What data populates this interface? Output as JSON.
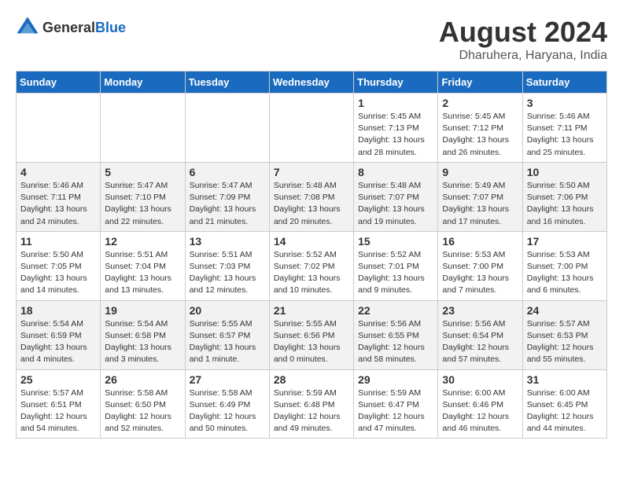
{
  "logo": {
    "text_general": "General",
    "text_blue": "Blue"
  },
  "title": "August 2024",
  "subtitle": "Dharuhera, Haryana, India",
  "days_header": [
    "Sunday",
    "Monday",
    "Tuesday",
    "Wednesday",
    "Thursday",
    "Friday",
    "Saturday"
  ],
  "weeks": [
    [
      {
        "num": "",
        "info": ""
      },
      {
        "num": "",
        "info": ""
      },
      {
        "num": "",
        "info": ""
      },
      {
        "num": "",
        "info": ""
      },
      {
        "num": "1",
        "info": "Sunrise: 5:45 AM\nSunset: 7:13 PM\nDaylight: 13 hours\nand 28 minutes."
      },
      {
        "num": "2",
        "info": "Sunrise: 5:45 AM\nSunset: 7:12 PM\nDaylight: 13 hours\nand 26 minutes."
      },
      {
        "num": "3",
        "info": "Sunrise: 5:46 AM\nSunset: 7:11 PM\nDaylight: 13 hours\nand 25 minutes."
      }
    ],
    [
      {
        "num": "4",
        "info": "Sunrise: 5:46 AM\nSunset: 7:11 PM\nDaylight: 13 hours\nand 24 minutes."
      },
      {
        "num": "5",
        "info": "Sunrise: 5:47 AM\nSunset: 7:10 PM\nDaylight: 13 hours\nand 22 minutes."
      },
      {
        "num": "6",
        "info": "Sunrise: 5:47 AM\nSunset: 7:09 PM\nDaylight: 13 hours\nand 21 minutes."
      },
      {
        "num": "7",
        "info": "Sunrise: 5:48 AM\nSunset: 7:08 PM\nDaylight: 13 hours\nand 20 minutes."
      },
      {
        "num": "8",
        "info": "Sunrise: 5:48 AM\nSunset: 7:07 PM\nDaylight: 13 hours\nand 19 minutes."
      },
      {
        "num": "9",
        "info": "Sunrise: 5:49 AM\nSunset: 7:07 PM\nDaylight: 13 hours\nand 17 minutes."
      },
      {
        "num": "10",
        "info": "Sunrise: 5:50 AM\nSunset: 7:06 PM\nDaylight: 13 hours\nand 16 minutes."
      }
    ],
    [
      {
        "num": "11",
        "info": "Sunrise: 5:50 AM\nSunset: 7:05 PM\nDaylight: 13 hours\nand 14 minutes."
      },
      {
        "num": "12",
        "info": "Sunrise: 5:51 AM\nSunset: 7:04 PM\nDaylight: 13 hours\nand 13 minutes."
      },
      {
        "num": "13",
        "info": "Sunrise: 5:51 AM\nSunset: 7:03 PM\nDaylight: 13 hours\nand 12 minutes."
      },
      {
        "num": "14",
        "info": "Sunrise: 5:52 AM\nSunset: 7:02 PM\nDaylight: 13 hours\nand 10 minutes."
      },
      {
        "num": "15",
        "info": "Sunrise: 5:52 AM\nSunset: 7:01 PM\nDaylight: 13 hours\nand 9 minutes."
      },
      {
        "num": "16",
        "info": "Sunrise: 5:53 AM\nSunset: 7:00 PM\nDaylight: 13 hours\nand 7 minutes."
      },
      {
        "num": "17",
        "info": "Sunrise: 5:53 AM\nSunset: 7:00 PM\nDaylight: 13 hours\nand 6 minutes."
      }
    ],
    [
      {
        "num": "18",
        "info": "Sunrise: 5:54 AM\nSunset: 6:59 PM\nDaylight: 13 hours\nand 4 minutes."
      },
      {
        "num": "19",
        "info": "Sunrise: 5:54 AM\nSunset: 6:58 PM\nDaylight: 13 hours\nand 3 minutes."
      },
      {
        "num": "20",
        "info": "Sunrise: 5:55 AM\nSunset: 6:57 PM\nDaylight: 13 hours\nand 1 minute."
      },
      {
        "num": "21",
        "info": "Sunrise: 5:55 AM\nSunset: 6:56 PM\nDaylight: 13 hours\nand 0 minutes."
      },
      {
        "num": "22",
        "info": "Sunrise: 5:56 AM\nSunset: 6:55 PM\nDaylight: 12 hours\nand 58 minutes."
      },
      {
        "num": "23",
        "info": "Sunrise: 5:56 AM\nSunset: 6:54 PM\nDaylight: 12 hours\nand 57 minutes."
      },
      {
        "num": "24",
        "info": "Sunrise: 5:57 AM\nSunset: 6:53 PM\nDaylight: 12 hours\nand 55 minutes."
      }
    ],
    [
      {
        "num": "25",
        "info": "Sunrise: 5:57 AM\nSunset: 6:51 PM\nDaylight: 12 hours\nand 54 minutes."
      },
      {
        "num": "26",
        "info": "Sunrise: 5:58 AM\nSunset: 6:50 PM\nDaylight: 12 hours\nand 52 minutes."
      },
      {
        "num": "27",
        "info": "Sunrise: 5:58 AM\nSunset: 6:49 PM\nDaylight: 12 hours\nand 50 minutes."
      },
      {
        "num": "28",
        "info": "Sunrise: 5:59 AM\nSunset: 6:48 PM\nDaylight: 12 hours\nand 49 minutes."
      },
      {
        "num": "29",
        "info": "Sunrise: 5:59 AM\nSunset: 6:47 PM\nDaylight: 12 hours\nand 47 minutes."
      },
      {
        "num": "30",
        "info": "Sunrise: 6:00 AM\nSunset: 6:46 PM\nDaylight: 12 hours\nand 46 minutes."
      },
      {
        "num": "31",
        "info": "Sunrise: 6:00 AM\nSunset: 6:45 PM\nDaylight: 12 hours\nand 44 minutes."
      }
    ]
  ]
}
